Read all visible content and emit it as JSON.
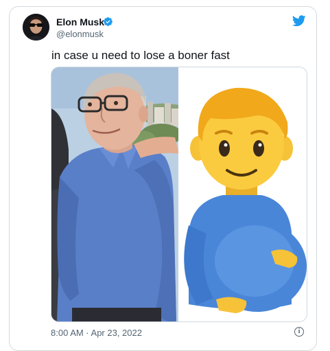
{
  "author": {
    "name": "Elon Musk",
    "handle": "@elonmusk",
    "verified": true
  },
  "tweet": {
    "text": "in case u need to lose a boner fast"
  },
  "media": {
    "left_image": "photo-of-man-in-blue-polo",
    "right_image": "pregnant-man-emoji"
  },
  "meta": {
    "timestamp": "8:00 AM · Apr 23, 2022",
    "info_glyph": "i"
  },
  "colors": {
    "twitter_blue": "#1d9bf0",
    "text_primary": "#0f1419",
    "text_secondary": "#536471",
    "border": "#cfd9de"
  },
  "icons": [
    "verified-badge-icon",
    "twitter-bird-icon",
    "info-icon"
  ]
}
